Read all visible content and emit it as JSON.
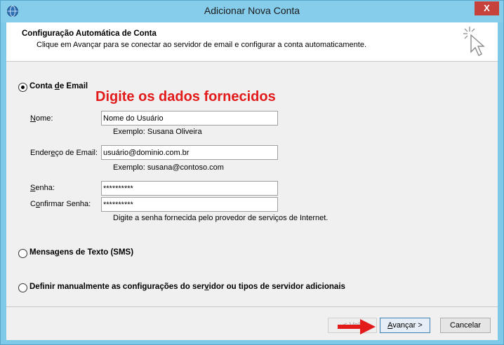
{
  "window": {
    "title": "Adicionar Nova Conta",
    "close_glyph": "X"
  },
  "header": {
    "title": "Configuração Automática de Conta",
    "subtitle": "Clique em Avançar para se conectar ao servidor de email e configurar a conta automaticamente."
  },
  "options": {
    "email_account": {
      "label_pre": "Conta ",
      "label_mnemonic": "d",
      "label_post": "e Email",
      "selected": true
    },
    "sms": {
      "label_pre": "Mensa",
      "label_mnemonic": "g",
      "label_post": "ens de Texto (SMS)",
      "selected": false
    },
    "manual": {
      "label_pre": "Definir manualmente as configurações do ser",
      "label_mnemonic": "v",
      "label_post": "idor ou tipos de servidor adicionais",
      "selected": false
    }
  },
  "annotation": {
    "text": "Digite os dados fornecidos",
    "color": "#e21a1a"
  },
  "fields": {
    "name": {
      "label_mnemonic": "N",
      "label_rest": "ome:",
      "value": "Nome do Usuário",
      "hint": "Exemplo: Susana Oliveira"
    },
    "email": {
      "label_pre": "Ender",
      "label_mnemonic": "e",
      "label_post": "ço de Email:",
      "value": "usuário@dominio.com.br",
      "hint": "Exemplo: susana@contoso.com"
    },
    "password": {
      "label_mnemonic": "S",
      "label_rest": "enha:",
      "value": "**********"
    },
    "confirm_password": {
      "label_pre": "C",
      "label_mnemonic": "o",
      "label_post": "nfirmar Senha:",
      "value": "**********",
      "hint": "Digite a senha fornecida pelo provedor de serviços de Internet."
    }
  },
  "buttons": {
    "back": "< Volt",
    "next_mnemonic": "A",
    "next_rest": "vançar >",
    "cancel": "Cancelar"
  }
}
